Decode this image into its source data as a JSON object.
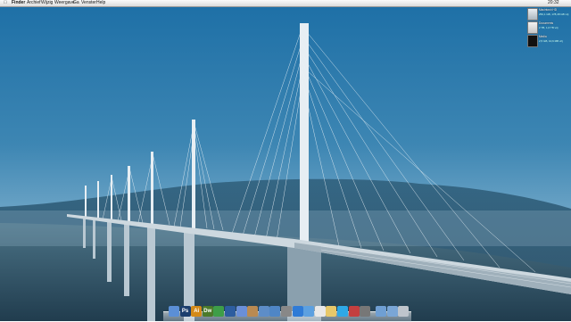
{
  "menubar": {
    "apple_icon": "apple-icon",
    "items": [
      "Finder",
      "Archief",
      "Wijzig",
      "Weergave",
      "Ga",
      "Venster",
      "Help"
    ],
    "clock": "20:32"
  },
  "desktop_icons": [
    {
      "name": "Macintosh HD",
      "info": "250,1 GB, 178,48 GB vrij",
      "icon": "hard-drive-icon"
    },
    {
      "name": "Documents",
      "info": "2 TB, 1,6 TB vrij",
      "icon": "drive-icon"
    },
    {
      "name": "Media",
      "info": "2,5 GB, 10,6 MB vrij",
      "icon": "drive-icon"
    }
  ],
  "dock": {
    "apps": [
      {
        "label": "",
        "name": "finder",
        "color": "#5b8fd6"
      },
      {
        "label": "Ps",
        "name": "photoshop",
        "color": "#1c3f6e"
      },
      {
        "label": "Ai",
        "name": "illustrator",
        "color": "#d48a18"
      },
      {
        "label": "Dw",
        "name": "dreamweaver",
        "color": "#4b7a2a"
      },
      {
        "label": "",
        "name": "chrome",
        "color": "#3e9e48"
      },
      {
        "label": "",
        "name": "xcode",
        "color": "#2d5d9f"
      },
      {
        "label": "",
        "name": "itunes",
        "color": "#6a8fd8"
      },
      {
        "label": "",
        "name": "address-book",
        "color": "#b98a52"
      },
      {
        "label": "",
        "name": "mail",
        "color": "#5d8dc8"
      },
      {
        "label": "",
        "name": "safari",
        "color": "#4f86c6"
      },
      {
        "label": "",
        "name": "system-preferences",
        "color": "#888888"
      },
      {
        "label": "",
        "name": "app-store",
        "color": "#2f7bd6"
      },
      {
        "label": "",
        "name": "messages",
        "color": "#5ca0e0"
      },
      {
        "label": "",
        "name": "calendar",
        "color": "#e8e8e8"
      },
      {
        "label": "",
        "name": "notes",
        "color": "#e7c86a"
      },
      {
        "label": "",
        "name": "skype",
        "color": "#2ea8e6"
      },
      {
        "label": "",
        "name": "photo-booth",
        "color": "#c43f3f"
      },
      {
        "label": "",
        "name": "activity-monitor",
        "color": "#777777"
      },
      {
        "label": "",
        "name": "applications-folder",
        "color": "#6f9fd3"
      },
      {
        "label": "",
        "name": "documents-folder",
        "color": "#7aa6d6"
      },
      {
        "label": "",
        "name": "trash",
        "color": "#bfc5cc"
      }
    ]
  },
  "wallpaper": "Millau Viaduct bridge over a misty valley"
}
